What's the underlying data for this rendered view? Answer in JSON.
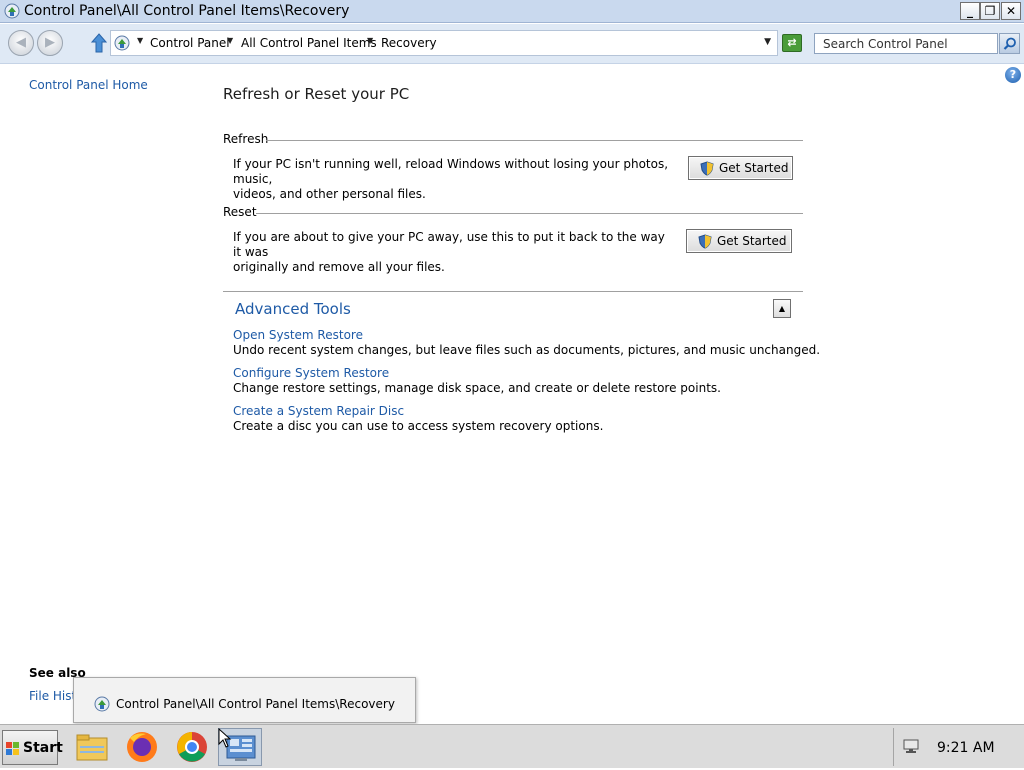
{
  "window": {
    "title": "Control Panel\\All Control Panel Items\\Recovery",
    "buttons": {
      "minimize": "_",
      "restore": "❐",
      "close": "✕"
    }
  },
  "address_bar": {
    "breadcrumbs": [
      "Control Panel",
      "All Control Panel Items",
      "Recovery"
    ],
    "search_placeholder": "Search Control Panel"
  },
  "left_nav": {
    "home_link": "Control Panel Home",
    "see_also_heading": "See also",
    "see_also_links": [
      "File Histo"
    ]
  },
  "main": {
    "title": "Refresh or Reset your PC",
    "sections": [
      {
        "heading": "Refresh",
        "lines": [
          "If your PC isn't running well, reload Windows without losing your photos, music,",
          "videos, and other personal files."
        ],
        "button": "Get Started"
      },
      {
        "heading": "Reset",
        "lines": [
          "If you are about to give your PC away, use this to put it back to the way it was",
          "originally and remove all your files."
        ],
        "button": "Get Started"
      }
    ],
    "advanced_tools": {
      "title": "Advanced Tools",
      "collapse_glyph": "▲",
      "items": [
        {
          "link": "Open System Restore",
          "description": "Undo recent system changes, but leave files such as documents, pictures, and music unchanged."
        },
        {
          "link": "Configure System Restore",
          "description": "Change restore settings, manage disk space, and create or delete restore points."
        },
        {
          "link": "Create a System Repair Disc",
          "description": "Create a disc you can use to access system recovery options."
        }
      ]
    }
  },
  "taskbar": {
    "start_label": "Start",
    "thumbnail_title": "Control Panel\\All Control Panel Items\\Recovery",
    "apps": [
      "file-explorer-icon",
      "firefox-icon",
      "chrome-icon",
      "control-panel-icon"
    ],
    "clock": "9:21 AM"
  },
  "colors": {
    "link": "#1e5aa6",
    "titlebar": "#c9d9ee",
    "taskbar": "#dcdcdc"
  }
}
